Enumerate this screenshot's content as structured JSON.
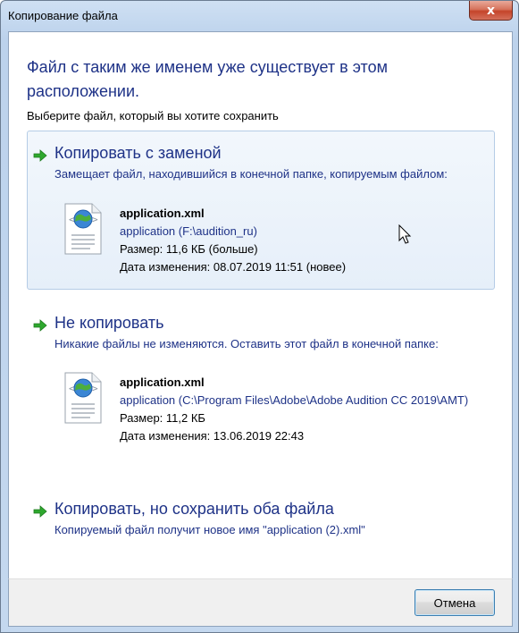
{
  "window": {
    "title": "Копирование файла",
    "close_glyph": "x"
  },
  "main": {
    "heading": "Файл с таким же именем уже существует в этом расположении.",
    "subheading": "Выберите файл, который вы хотите сохранить"
  },
  "options": [
    {
      "title": "Копировать с заменой",
      "description": "Замещает файл, находившийся в конечной папке, копируемым файлом:",
      "file": {
        "name": "application.xml",
        "path": "application (F:\\audition_ru)",
        "size": "Размер: 11,6 КБ (больше)",
        "modified": "Дата изменения: 08.07.2019 11:51 (новее)"
      }
    },
    {
      "title": "Не копировать",
      "description": "Никакие файлы не изменяются. Оставить этот файл в конечной папке:",
      "file": {
        "name": "application.xml",
        "path": "application (C:\\Program Files\\Adobe\\Adobe Audition CC 2019\\AMT)",
        "size": "Размер: 11,2 КБ",
        "modified": "Дата изменения: 13.06.2019 22:43"
      }
    },
    {
      "title": "Копировать, но сохранить оба файла",
      "description": "Копируемый файл получит новое имя \"application (2).xml\""
    }
  ],
  "footer": {
    "cancel_label": "Отмена"
  },
  "colors": {
    "link_blue": "#1e3287",
    "arrow_green": "#2ea82e"
  },
  "icons": {
    "option_arrow": "green-arrow-icon",
    "file": "xml-file-icon"
  }
}
